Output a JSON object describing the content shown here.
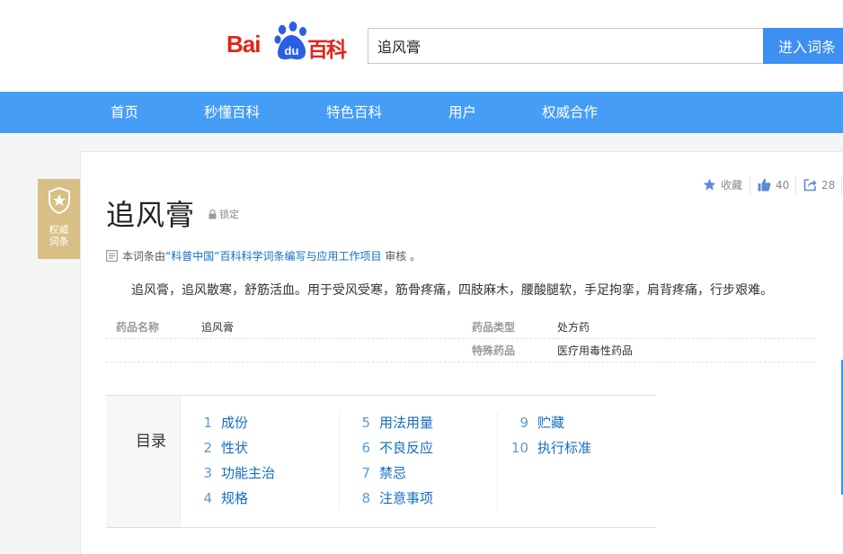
{
  "header": {
    "logo": {
      "bai": "Bai",
      "du": "du",
      "baike": "百科"
    },
    "search": {
      "value": "追风膏",
      "placeholder": ""
    },
    "search_button": "进入词条"
  },
  "nav": [
    {
      "label": "首页"
    },
    {
      "label": "秒懂百科"
    },
    {
      "label": "特色百科"
    },
    {
      "label": "用户"
    },
    {
      "label": "权威合作"
    }
  ],
  "badge": {
    "line1": "权威",
    "line2": "词条"
  },
  "entry": {
    "title": "追风膏",
    "lock_label": "锁定",
    "actions": {
      "favorite": "收藏",
      "likes": "40",
      "shares": "28"
    },
    "review": {
      "prefix": "本词条由",
      "link": "“科普中国”百科科学词条编写与应用工作项目",
      "suffix": " 审核 。"
    },
    "summary": "追风膏，追风散寒，舒筋活血。用于受风受寒，筋骨疼痛，四肢麻木，腰酸腿软，手足拘挛，肩背疼痛，行步艰难。",
    "info": {
      "rows": [
        {
          "k1": "药品名称",
          "v1": "追风膏",
          "k2": "药品类型",
          "v2": "处方药"
        },
        {
          "k1": "",
          "v1": "",
          "k2": "特殊药品",
          "v2": "医疗用毒性药品"
        }
      ]
    }
  },
  "toc": {
    "label": "目录",
    "items": [
      {
        "num": "1",
        "label": "成份"
      },
      {
        "num": "2",
        "label": "性状"
      },
      {
        "num": "3",
        "label": "功能主治"
      },
      {
        "num": "4",
        "label": "规格"
      },
      {
        "num": "5",
        "label": "用法用量"
      },
      {
        "num": "6",
        "label": "不良反应"
      },
      {
        "num": "7",
        "label": "禁忌"
      },
      {
        "num": "8",
        "label": "注意事项"
      },
      {
        "num": "9",
        "label": "贮藏"
      },
      {
        "num": "10",
        "label": "执行标准"
      }
    ]
  },
  "colors": {
    "brand_red": "#e1251b",
    "brand_blue": "#2b5fe2",
    "nav_blue": "#459df5",
    "button_blue": "#3d8ff2",
    "link_blue": "#136ec2",
    "badge_gold": "#d7bf85"
  }
}
